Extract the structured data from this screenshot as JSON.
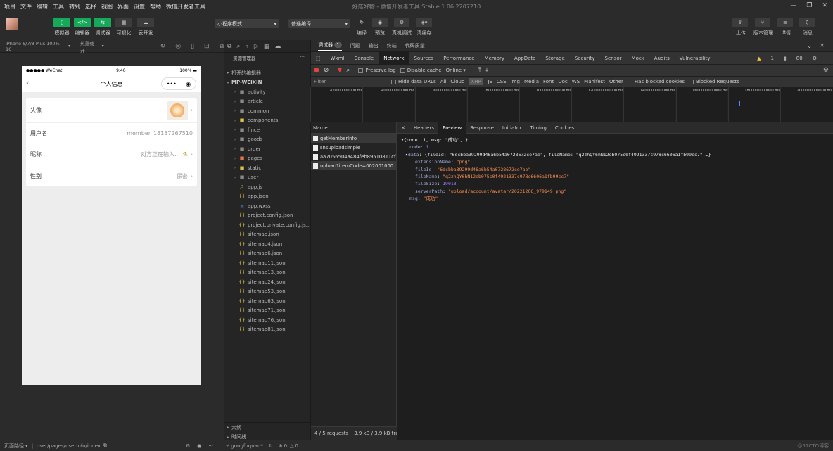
{
  "menu": [
    "项目",
    "文件",
    "编辑",
    "工具",
    "转到",
    "选择",
    "视图",
    "界面",
    "设置",
    "帮助",
    "微信开发者工具"
  ],
  "app_title": "好店好物 - 微信开发者工具 Stable 1.06.2207210",
  "toolbar": {
    "left_buttons": [
      {
        "icon": "phone-icon",
        "label": "模拟器"
      },
      {
        "icon": "code-icon",
        "label": "编辑器"
      },
      {
        "icon": "debug-icon",
        "label": "调试器"
      },
      {
        "icon": "visual-icon",
        "label": "可视化"
      },
      {
        "icon": "cloud-icon",
        "label": "云开发"
      }
    ],
    "mode_select": "小程序模式",
    "compile_select": "普通编译",
    "mid_buttons": [
      {
        "icon": "refresh-icon",
        "label": "编译"
      },
      {
        "icon": "eye-icon",
        "label": "预览"
      },
      {
        "icon": "device-icon",
        "label": "真机调试"
      },
      {
        "icon": "clear-cache-icon",
        "label": "清缓存"
      }
    ],
    "right_buttons": [
      {
        "icon": "upload-icon",
        "label": "上传"
      },
      {
        "icon": "branch-icon",
        "label": "版本管理"
      },
      {
        "icon": "details-icon",
        "label": "详情"
      },
      {
        "icon": "bell-icon",
        "label": "消息"
      }
    ]
  },
  "simulator": {
    "device": "iPhone 6/7/8 Plus 100% 16",
    "hotreload": "热重载 开",
    "status_left": "●●●●● WeChat",
    "status_time": "9:40",
    "status_battery": "100%",
    "nav_title": "个人信息",
    "rows": [
      {
        "label": "头像",
        "value": ""
      },
      {
        "label": "用户名",
        "value": "member_18137267510"
      },
      {
        "label": "昵称",
        "value": "对方正在输入..."
      },
      {
        "label": "性别",
        "value": "保密"
      }
    ]
  },
  "explorer": {
    "title": "资源管理器",
    "open_editors": "打开的编辑器",
    "project": "MP-WEIXIN",
    "items": [
      {
        "name": "activity",
        "type": "folder",
        "color": "grey"
      },
      {
        "name": "article",
        "type": "folder",
        "color": "grey"
      },
      {
        "name": "common",
        "type": "folder",
        "color": "grey"
      },
      {
        "name": "components",
        "type": "folder",
        "color": "yellow"
      },
      {
        "name": "fince",
        "type": "folder",
        "color": "grey"
      },
      {
        "name": "goods",
        "type": "folder",
        "color": "grey"
      },
      {
        "name": "order",
        "type": "folder",
        "color": "grey"
      },
      {
        "name": "pages",
        "type": "folder",
        "color": "red"
      },
      {
        "name": "static",
        "type": "folder",
        "color": "yellow"
      },
      {
        "name": "user",
        "type": "folder",
        "color": "grey"
      },
      {
        "name": "app.js",
        "type": "js"
      },
      {
        "name": "app.json",
        "type": "json"
      },
      {
        "name": "app.wxss",
        "type": "wxss"
      },
      {
        "name": "project.config.json",
        "type": "json"
      },
      {
        "name": "project.private.config.js...",
        "type": "json"
      },
      {
        "name": "sitemap.json",
        "type": "json"
      },
      {
        "name": "sitemap4.json",
        "type": "json"
      },
      {
        "name": "sitemap6.json",
        "type": "json"
      },
      {
        "name": "sitemap11.json",
        "type": "json"
      },
      {
        "name": "sitemap13.json",
        "type": "json"
      },
      {
        "name": "sitemap24.json",
        "type": "json"
      },
      {
        "name": "sitemap53.json",
        "type": "json"
      },
      {
        "name": "sitemap63.json",
        "type": "json"
      },
      {
        "name": "sitemap71.json",
        "type": "json"
      },
      {
        "name": "sitemap76.json",
        "type": "json"
      },
      {
        "name": "sitemap81.json",
        "type": "json"
      }
    ],
    "outline": "大纲",
    "timeline": "时间线"
  },
  "devtools": {
    "top_tabs": [
      {
        "label": "调试器",
        "badge": "1"
      },
      {
        "label": "问题"
      },
      {
        "label": "输出"
      },
      {
        "label": "终端"
      },
      {
        "label": "代码质量"
      }
    ],
    "sub_tabs": [
      "Wxml",
      "Console",
      "Network",
      "Sources",
      "Performance",
      "Memory",
      "AppData",
      "Storage",
      "Security",
      "Sensor",
      "Mock",
      "Audits",
      "Vulnerability"
    ],
    "active_sub_tab": "Network",
    "warning_count": "1",
    "error_count": "80",
    "preserve_log": "Preserve log",
    "disable_cache": "Disable cache",
    "throttle": "Online",
    "filter_placeholder": "Filter",
    "hide_data_urls": "Hide data URLs",
    "filter_types": [
      "All",
      "Cloud",
      "XHR",
      "JS",
      "CSS",
      "Img",
      "Media",
      "Font",
      "Doc",
      "WS",
      "Manifest",
      "Other"
    ],
    "active_filter": "XHR",
    "has_blocked_cookies": "Has blocked cookies",
    "blocked_requests": "Blocked Requests",
    "timeline_ticks": [
      "200000000000 ms",
      "400000000000 ms",
      "600000000000 ms",
      "800000000000 ms",
      "1000000000000 ms",
      "1200000000000 ms",
      "1400000000000 ms",
      "1600000000000 ms",
      "1800000000000 ms",
      "2000000000000 ms"
    ],
    "name_header": "Name",
    "requests": [
      "getMemberInfo",
      "snsuploadsimple",
      "aa7056504a484feb89510811cf...",
      "upload?itemCode=002001000..."
    ],
    "footer": "4 / 5 requests",
    "footer_size": "3.9 kB / 3.9 kB tra",
    "detail_tabs": [
      "Headers",
      "Preview",
      "Response",
      "Initiator",
      "Timing",
      "Cookies"
    ],
    "active_detail_tab": "Preview",
    "json_lines": {
      "l1": "{code: 1, msg: \"成功\",…}",
      "code_k": "code",
      "code_v": "1",
      "data_k": "data",
      "data_summary": "{fileId: \"6dcbba39299d46a6b54a0728672ce7ae\", fileName: \"q2zhQY6hN12eb075c0f4921337c978c6606a1fb99cc7\",…}",
      "ext_k": "extensionName",
      "ext_v": "\"png\"",
      "fileId_k": "fileId",
      "fileId_v": "\"6dcbba39299d46a6b54a0728672ce7ae\"",
      "fileName_k": "fileName",
      "fileName_v": "\"q2zhQY6hN12eb075c0f4921337c978c6606a1fb99cc7\"",
      "fileSize_k": "fileSize",
      "fileSize_v": "19013",
      "serverPath_k": "serverPath",
      "serverPath_v": "\"upload/account/avatar/20221206_979149.png\"",
      "msg_k": "msg",
      "msg_v": "\"成功\""
    }
  },
  "statusbar": {
    "path_label": "页面路径",
    "path": "user/pages/userInfo/index",
    "branch": "gongfuquan*",
    "errors": "0",
    "warnings": "0",
    "watermark": "@51CTO博客"
  }
}
